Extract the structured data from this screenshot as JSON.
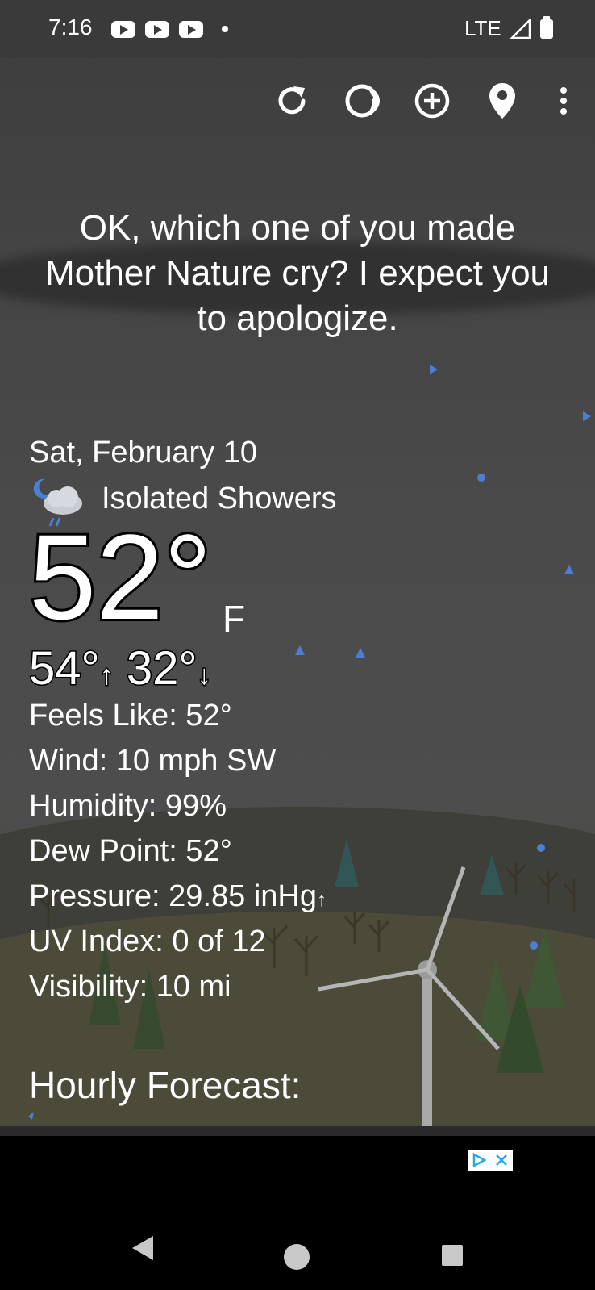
{
  "status_bar": {
    "time": "7:16",
    "network": "LTE",
    "notification_icons": [
      "youtube-icon",
      "youtube-icon",
      "youtube-icon",
      "more-notifications-dot"
    ]
  },
  "toolbar": {
    "icons": [
      "refresh-icon",
      "theme-icon",
      "add-location-icon",
      "location-pin-icon",
      "overflow-menu-icon"
    ]
  },
  "headline": "OK, which one of you made Mother Nature cry? I expect you to apologize.",
  "weather": {
    "date": "Sat, February 10",
    "condition": "Isolated Showers",
    "condition_icon": "night-showers-icon",
    "temperature": "52°",
    "unit": "F",
    "high": "54°",
    "high_arrow": "↑",
    "low": "32°",
    "low_arrow": "↓"
  },
  "details": {
    "feels_like": "Feels Like:  52°",
    "wind": "Wind:  10 mph SW",
    "humidity": "Humidity:  99%",
    "dew_point": "Dew Point:  52°",
    "pressure": "Pressure:  29.85 inHg",
    "pressure_arrow": "↑",
    "uv_index": "UV Index:  0 of 12",
    "visibility": "Visibility:  10 mi"
  },
  "hourly_forecast_title": "Hourly Forecast:",
  "ad": {
    "icons": [
      "adchoices-icon",
      "close-ad-icon"
    ]
  },
  "nav": {
    "icons": [
      "back-icon",
      "home-icon",
      "recents-icon"
    ]
  },
  "colors": {
    "accent": "#4a7fd4",
    "sky": "#464646",
    "text": "#ffffff"
  }
}
